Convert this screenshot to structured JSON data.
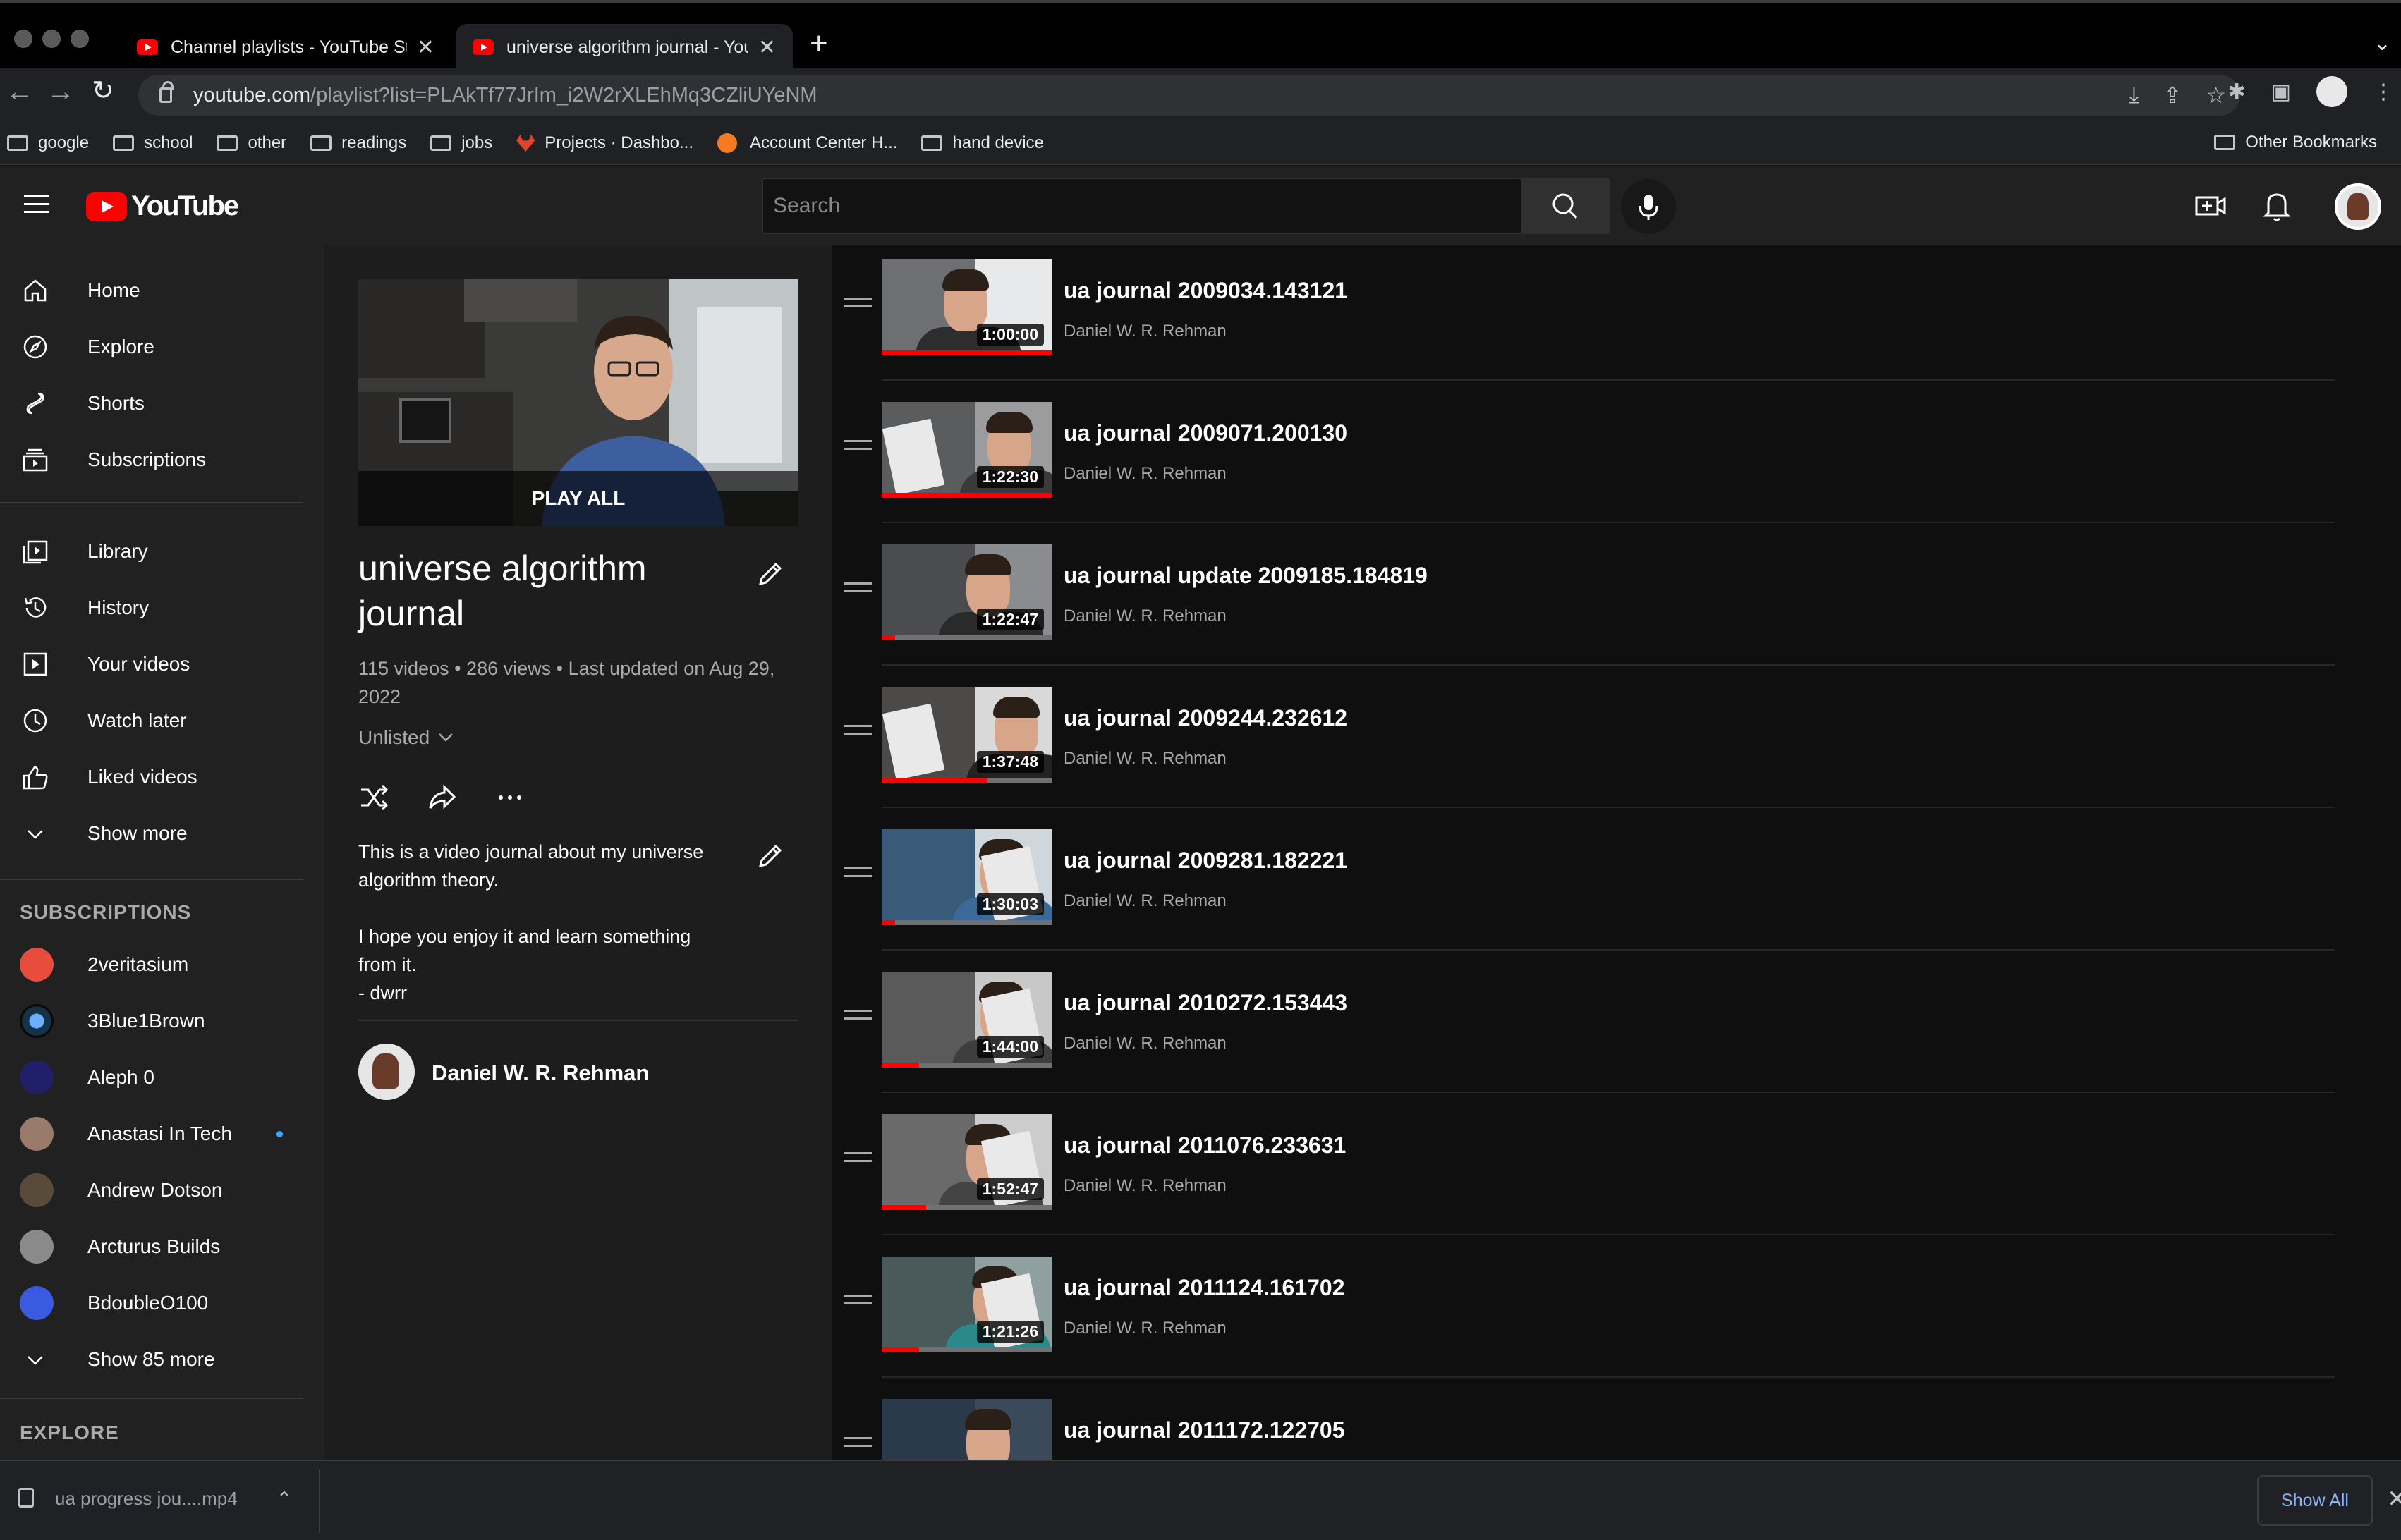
{
  "browser": {
    "tabs": [
      {
        "title": "Channel playlists - YouTube Studio",
        "active": false
      },
      {
        "title": "universe algorithm journal - YouTube",
        "active": true
      }
    ],
    "new_tab": "+",
    "close": "✕",
    "url_host": "youtube.com",
    "url_path": "/playlist?list=PLAkTf77JrIm_i2W2rXLEhMq3CZliUYeNM",
    "bookmarks": [
      {
        "label": "google",
        "icon": "folder-icon"
      },
      {
        "label": "school",
        "icon": "folder-icon"
      },
      {
        "label": "other",
        "icon": "folder-icon"
      },
      {
        "label": "readings",
        "icon": "folder-icon"
      },
      {
        "label": "jobs",
        "icon": "folder-icon"
      },
      {
        "label": "Projects · Dashbo...",
        "icon": "gitlab-icon"
      },
      {
        "label": "Account Center H...",
        "icon": "orange-circle-icon"
      },
      {
        "label": "hand device",
        "icon": "folder-icon"
      }
    ],
    "other_bookmarks": "Other Bookmarks"
  },
  "youtube": {
    "logo_text": "YouTube",
    "search_placeholder": "Search"
  },
  "sidebar": {
    "main": [
      {
        "label": "Home",
        "icon": "home-icon"
      },
      {
        "label": "Explore",
        "icon": "compass-icon"
      },
      {
        "label": "Shorts",
        "icon": "shorts-icon"
      },
      {
        "label": "Subscriptions",
        "icon": "subscriptions-icon"
      }
    ],
    "library": [
      {
        "label": "Library",
        "icon": "library-icon"
      },
      {
        "label": "History",
        "icon": "history-icon"
      },
      {
        "label": "Your videos",
        "icon": "your-videos-icon"
      },
      {
        "label": "Watch later",
        "icon": "clock-icon"
      },
      {
        "label": "Liked videos",
        "icon": "thumbs-up-icon"
      },
      {
        "label": "Show more",
        "icon": "chevron-down-icon"
      }
    ],
    "subscriptions_heading": "SUBSCRIPTIONS",
    "subscriptions": [
      {
        "label": "2veritasium",
        "color": "#e84c3d",
        "new": false
      },
      {
        "label": "3Blue1Brown",
        "color": "#1a2a3a",
        "new": false
      },
      {
        "label": "Aleph 0",
        "color": "#2a2a7a",
        "new": false
      },
      {
        "label": "Anastasi In Tech",
        "color": "#9a7a6a",
        "new": true
      },
      {
        "label": "Andrew Dotson",
        "color": "#5a4a3a",
        "new": false
      },
      {
        "label": "Arcturus Builds",
        "color": "#8a8a8a",
        "new": false
      },
      {
        "label": "BdoubleO100",
        "color": "#3a5ae0",
        "new": false
      }
    ],
    "show_more_subs": "Show 85 more",
    "explore_heading": "EXPLORE"
  },
  "playlist": {
    "play_all": "PLAY ALL",
    "title": "universe algorithm journal",
    "meta": "115 videos • 286 views • Last updated on Aug 29, 2022",
    "privacy": "Unlisted",
    "description": "This is a video journal about my universe algorithm theory.\n\nI hope you enjoy it and learn something from it.\n - dwrr",
    "owner": "Daniel W. R. Rehman"
  },
  "videos": [
    {
      "title": "ua journal 2009034.143121",
      "channel": "Daniel W. R. Rehman",
      "duration": "1:00:00",
      "progress": 1.0
    },
    {
      "title": "ua journal 2009071.200130",
      "channel": "Daniel W. R. Rehman",
      "duration": "1:22:30",
      "progress": 1.0
    },
    {
      "title": "ua journal update 2009185.184819",
      "channel": "Daniel W. R. Rehman",
      "duration": "1:22:47",
      "progress": 0.08
    },
    {
      "title": "ua journal 2009244.232612",
      "channel": "Daniel W. R. Rehman",
      "duration": "1:37:48",
      "progress": 0.62
    },
    {
      "title": "ua journal 2009281.182221",
      "channel": "Daniel W. R. Rehman",
      "duration": "1:30:03",
      "progress": 0.08
    },
    {
      "title": "ua journal 2010272.153443",
      "channel": "Daniel W. R. Rehman",
      "duration": "1:44:00",
      "progress": 0.22
    },
    {
      "title": "ua journal 2011076.233631",
      "channel": "Daniel W. R. Rehman",
      "duration": "1:52:47",
      "progress": 0.26
    },
    {
      "title": "ua journal 2011124.161702",
      "channel": "Daniel W. R. Rehman",
      "duration": "1:21:26",
      "progress": 0.22
    },
    {
      "title": "ua journal 2011172.122705",
      "channel": "",
      "duration": "",
      "progress": 0
    }
  ],
  "downloads": {
    "file": "ua progress jou....mp4",
    "show_all": "Show All"
  }
}
